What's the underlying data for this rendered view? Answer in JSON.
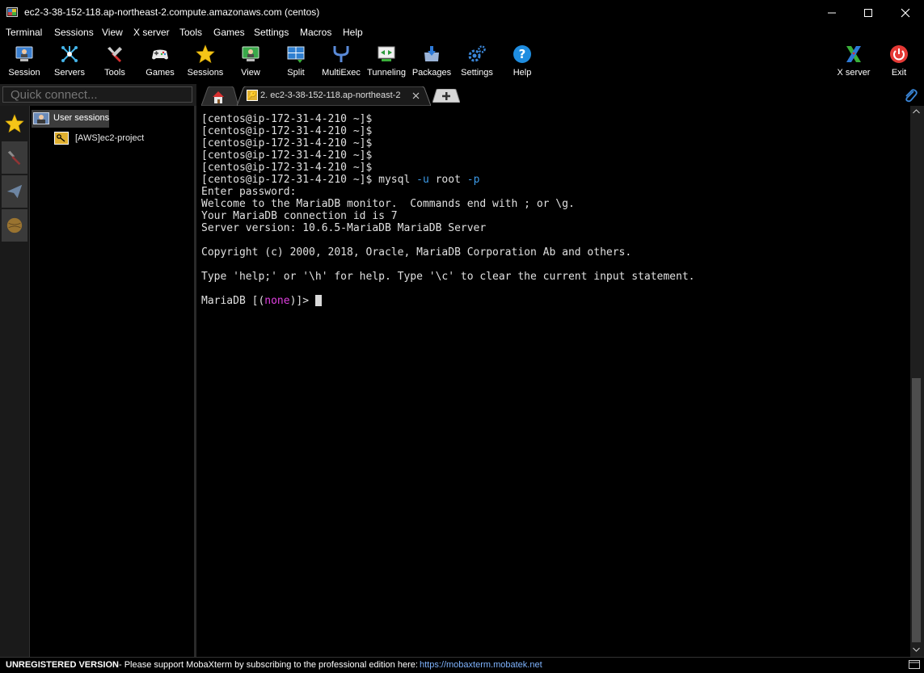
{
  "window": {
    "title": "ec2-3-38-152-118.ap-northeast-2.compute.amazonaws.com (centos)"
  },
  "menu": [
    "Terminal",
    "Sessions",
    "View",
    "X server",
    "Tools",
    "Games",
    "Settings",
    "Macros",
    "Help"
  ],
  "toolbar": {
    "buttons": [
      {
        "label": "Session",
        "icon": "session-monitor-icon"
      },
      {
        "label": "Servers",
        "icon": "servers-icon"
      },
      {
        "label": "Tools",
        "icon": "tools-icon"
      },
      {
        "label": "Games",
        "icon": "gamepad-icon"
      },
      {
        "label": "Sessions",
        "icon": "star-icon"
      },
      {
        "label": "View",
        "icon": "view-icon"
      },
      {
        "label": "Split",
        "icon": "split-icon"
      },
      {
        "label": "MultiExec",
        "icon": "multiexec-icon"
      },
      {
        "label": "Tunneling",
        "icon": "tunneling-icon"
      },
      {
        "label": "Packages",
        "icon": "packages-icon"
      },
      {
        "label": "Settings",
        "icon": "gears-icon"
      },
      {
        "label": "Help",
        "icon": "help-icon"
      }
    ],
    "right_buttons": [
      {
        "label": "X server",
        "icon": "x-server-icon"
      },
      {
        "label": "Exit",
        "icon": "power-icon"
      }
    ]
  },
  "quick_connect": {
    "placeholder": "Quick connect..."
  },
  "tabs": {
    "active_label": "2. ec2-3-38-152-118.ap-northeast-2"
  },
  "sidebar": {
    "root_label": "User sessions",
    "session_label": "[AWS]ec2-project"
  },
  "terminal": {
    "prompt": "[centos@ip-172-31-4-210 ~]$",
    "command": {
      "name": "mysql",
      "flag_user": "-u",
      "user": "root",
      "flag_password": "-p"
    },
    "output_lines": [
      "Enter password:",
      "Welcome to the MariaDB monitor.  Commands end with ; or \\g.",
      "Your MariaDB connection id is 7",
      "Server version: 10.6.5-MariaDB MariaDB Server",
      "",
      "Copyright (c) 2000, 2018, Oracle, MariaDB Corporation Ab and others.",
      "",
      "Type 'help;' or '\\h' for help. Type '\\c' to clear the current input statement.",
      ""
    ],
    "mariadb_prompt_prefix": "MariaDB [(",
    "mariadb_db": "none",
    "mariadb_prompt_suffix": ")]>"
  },
  "status": {
    "unregistered": "UNREGISTERED VERSION",
    "message": "-  Please support MobaXterm by subscribing to the professional edition here:",
    "link": "https://mobaxterm.mobatek.net"
  },
  "colors": {
    "terminal_bg": "#000000",
    "terminal_fg": "#e0e0e0",
    "flag_blue": "#3d9be8",
    "db_magenta": "#e040e0",
    "status_link": "#7fb4ff"
  }
}
